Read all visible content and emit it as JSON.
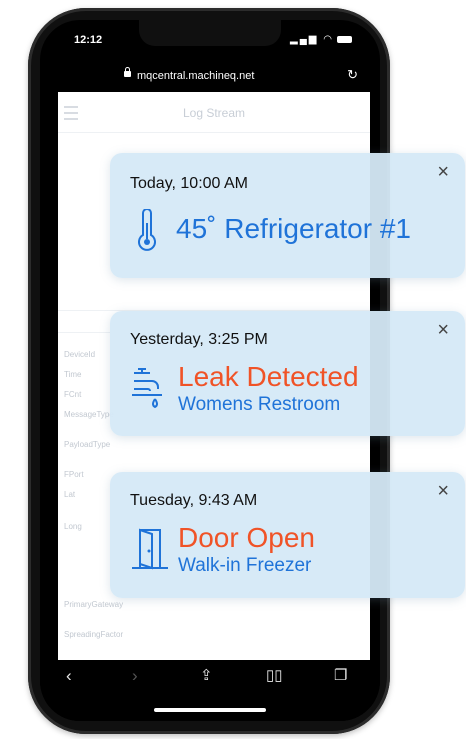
{
  "status_bar": {
    "time": "12:12"
  },
  "browser": {
    "url": "mqcentral.machineq.net"
  },
  "page": {
    "title": "Log Stream",
    "faint_rows": [
      {
        "label": "DeviceId",
        "value": ""
      },
      {
        "label": "Time",
        "value": ""
      },
      {
        "label": "FCnt",
        "value": ""
      },
      {
        "label": "MessageType",
        "value": ""
      },
      {
        "label": "PayloadType",
        "value": ""
      },
      {
        "label": "FPort",
        "value": ""
      },
      {
        "label": "Lat",
        "value": ""
      },
      {
        "label": "Long",
        "value": ""
      },
      {
        "label": "PrimaryGateway",
        "value": ""
      },
      {
        "label": "SpreadingFactor",
        "value": ""
      }
    ]
  },
  "notifications": [
    {
      "time_label": "Today, 10:00 AM",
      "title": "45˚ Refrigerator #1",
      "subtitle": "",
      "icon": "thermometer-icon",
      "title_color": "#1f73d8"
    },
    {
      "time_label": "Yesterday, 3:25 PM",
      "title": "Leak Detected",
      "subtitle": "Womens Restroom",
      "icon": "faucet-leak-icon",
      "title_color": "#f05327"
    },
    {
      "time_label": "Tuesday, 9:43 AM",
      "title": "Door Open",
      "subtitle": "Walk-in Freezer",
      "icon": "door-icon",
      "title_color": "#f05327"
    }
  ],
  "close_symbol": "×",
  "toolbar_icons": [
    "back-icon",
    "forward-icon",
    "share-icon",
    "bookmarks-icon",
    "tabs-icon"
  ]
}
